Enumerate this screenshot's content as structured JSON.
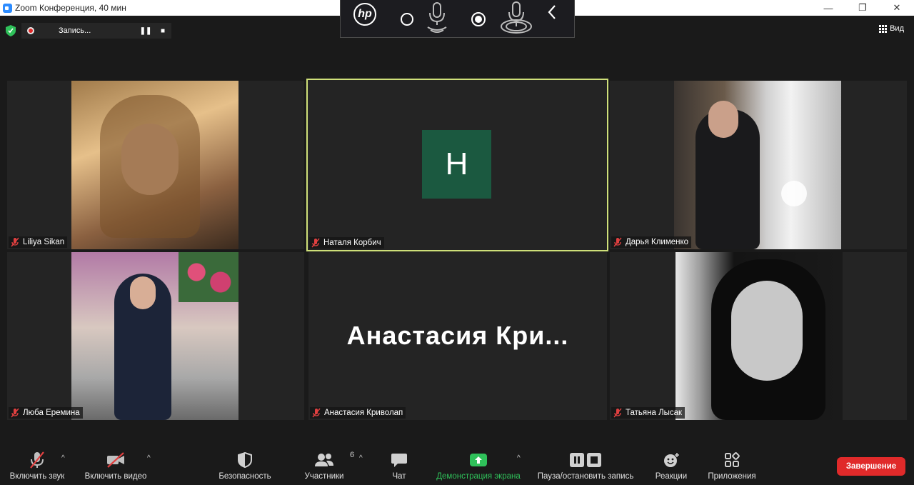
{
  "window": {
    "title": "Zoom Конференция, 40 мин"
  },
  "window_controls": {
    "minimize": "—",
    "maximize": "❐",
    "close": "✕"
  },
  "hp_bar": {
    "logo": "hp"
  },
  "recording": {
    "label": "Запись..."
  },
  "view": {
    "label": "Вид"
  },
  "tiles": [
    {
      "name": "Liliya Sikan"
    },
    {
      "name": "Наталя Корбич",
      "initial": "Н"
    },
    {
      "name": "Дарья Клименко"
    },
    {
      "name": "Люба Еремина"
    },
    {
      "name": "Анастасия Криволап",
      "big_label": "Анастасия  Кри..."
    },
    {
      "name": "Татьяна Лысак"
    }
  ],
  "toolbar": {
    "audio": "Включить звук",
    "video": "Включить видео",
    "security": "Безопасность",
    "participants": "Участники",
    "participants_count": "6",
    "chat": "Чат",
    "share": "Демонстрация экрана",
    "record": "Пауза/остановить запись",
    "reactions": "Реакции",
    "apps": "Приложения",
    "end": "Завершение"
  },
  "colors": {
    "accent_green": "#2fc15a",
    "end_red": "#e02a2a",
    "active_border": "#cfe07a",
    "avatar_bg": "#1b5940"
  }
}
